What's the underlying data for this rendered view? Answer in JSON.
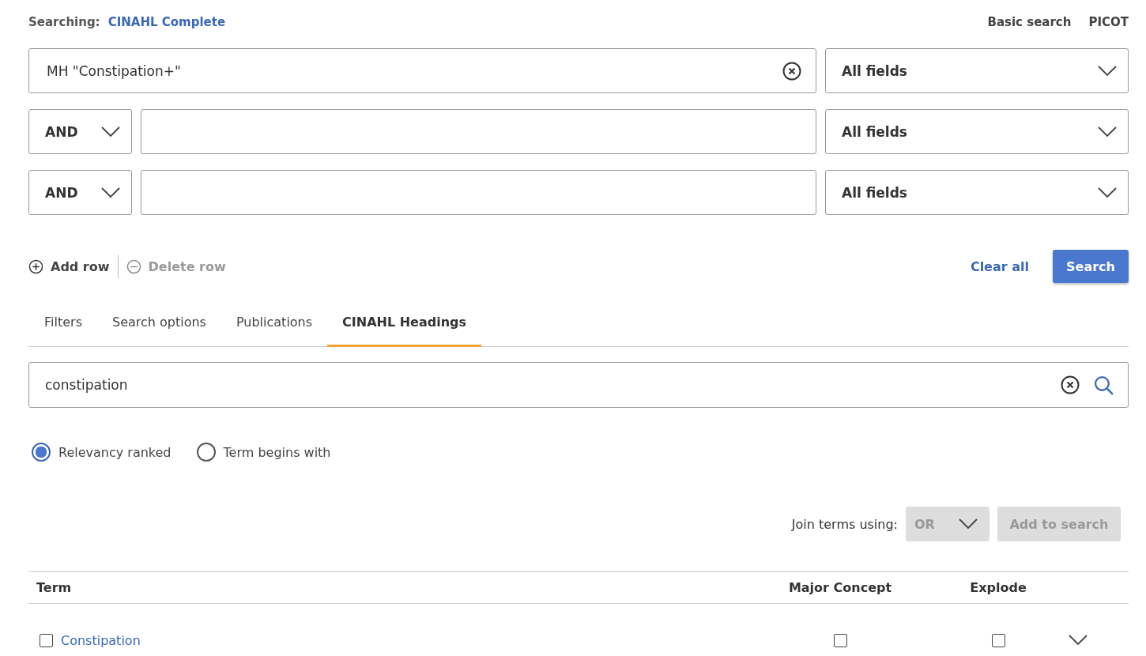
{
  "header": {
    "label": "Searching:",
    "database": "CINAHL Complete",
    "links": [
      "Basic search",
      "PICOT"
    ]
  },
  "query_rows": [
    {
      "value": "MH \"Constipation+\"",
      "field": "All fields"
    },
    {
      "operator": "AND",
      "field": "All fields"
    },
    {
      "operator": "AND",
      "field": "All fields"
    }
  ],
  "row_actions": [
    {
      "kind": "add",
      "label": "Add row",
      "disabled": false
    },
    {
      "kind": "delete",
      "label": "Delete row",
      "disabled": true
    }
  ],
  "clear_all": "Clear all",
  "search_button": "Search",
  "tabs": [
    {
      "label": "Filters",
      "selected": false
    },
    {
      "label": "Search options",
      "selected": false
    },
    {
      "label": "Publications",
      "selected": false
    },
    {
      "label": "CINAHL Headings",
      "selected": true
    }
  ],
  "headings_search": {
    "value": "constipation"
  },
  "radios": [
    {
      "label": "Relevancy ranked",
      "selected": true
    },
    {
      "label": "Term begins with",
      "selected": false
    }
  ],
  "join": {
    "label": "Join terms using:",
    "operator": "OR",
    "disabled": true
  },
  "add_to_search": {
    "label": "Add to search",
    "disabled": true
  },
  "table": {
    "columns": [
      "Term",
      "Major Concept",
      "Explode"
    ],
    "rows": [
      {
        "term": "Constipation",
        "checked": false,
        "major_concept": false,
        "explode": false,
        "expanded": false
      }
    ]
  }
}
